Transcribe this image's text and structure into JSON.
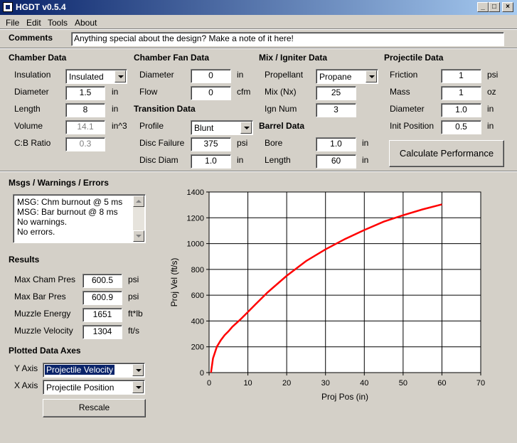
{
  "window": {
    "title": "HGDT v0.5.4"
  },
  "menu": [
    "File",
    "Edit",
    "Tools",
    "About"
  ],
  "comments": {
    "label": "Comments",
    "value": "Anything special about the design?  Make a note of it here!"
  },
  "chamber": {
    "title": "Chamber Data",
    "insulation": {
      "label": "Insulation",
      "value": "Insulated"
    },
    "diameter": {
      "label": "Diameter",
      "value": "1.5",
      "unit": "in"
    },
    "length": {
      "label": "Length",
      "value": "8",
      "unit": "in"
    },
    "volume": {
      "label": "Volume",
      "value": "14.1",
      "unit": "in^3"
    },
    "cb_ratio": {
      "label": "C:B Ratio",
      "value": "0.3"
    }
  },
  "fan": {
    "title": "Chamber Fan Data",
    "diameter": {
      "label": "Diameter",
      "value": "0",
      "unit": "in"
    },
    "flow": {
      "label": "Flow",
      "value": "0",
      "unit": "cfm"
    }
  },
  "transition": {
    "title": "Transition Data",
    "profile": {
      "label": "Profile",
      "value": "Blunt"
    },
    "disc_failure": {
      "label": "Disc Failure",
      "value": "375",
      "unit": "psi"
    },
    "disc_diam": {
      "label": "Disc Diam",
      "value": "1.0",
      "unit": "in"
    }
  },
  "mix": {
    "title": "Mix / Igniter Data",
    "propellant": {
      "label": "Propellant",
      "value": "Propane"
    },
    "mix": {
      "label": "Mix (Nx)",
      "value": "25"
    },
    "ign_num": {
      "label": "Ign Num",
      "value": "3"
    }
  },
  "barrel": {
    "title": "Barrel Data",
    "bore": {
      "label": "Bore",
      "value": "1.0",
      "unit": "in"
    },
    "length": {
      "label": "Length",
      "value": "60",
      "unit": "in"
    }
  },
  "projectile": {
    "title": "Projectile Data",
    "friction": {
      "label": "Friction",
      "value": "1",
      "unit": "psi"
    },
    "mass": {
      "label": "Mass",
      "value": "1",
      "unit": "oz"
    },
    "diameter": {
      "label": "Diameter",
      "value": "1.0",
      "unit": "in"
    },
    "init_position": {
      "label": "Init Position",
      "value": "0.5",
      "unit": "in"
    }
  },
  "calculate_button": "Calculate Performance",
  "messages": {
    "title": "Msgs / Warnings / Errors",
    "lines": [
      "MSG: Chm burnout @ 5 ms",
      "MSG: Bar burnout @ 8 ms",
      "No warnings.",
      "No errors."
    ]
  },
  "results": {
    "title": "Results",
    "max_cham_pres": {
      "label": "Max Cham Pres",
      "value": "600.5",
      "unit": "psi"
    },
    "max_bar_pres": {
      "label": "Max Bar Pres",
      "value": "600.9",
      "unit": "psi"
    },
    "muzzle_energy": {
      "label": "Muzzle Energy",
      "value": "1651",
      "unit": "ft*lb"
    },
    "muzzle_velocity": {
      "label": "Muzzle Velocity",
      "value": "1304",
      "unit": "ft/s"
    }
  },
  "axes": {
    "title": "Plotted Data Axes",
    "y_axis": {
      "label": "Y Axis",
      "value": "Projectile Velocity"
    },
    "x_axis": {
      "label": "X Axis",
      "value": "Projectile Position"
    },
    "rescale": "Rescale"
  },
  "chart_data": {
    "type": "line",
    "xlabel": "Proj Pos (in)",
    "ylabel": "Proj Vel (ft/s)",
    "xlim": [
      0,
      70
    ],
    "ylim": [
      0,
      1400
    ],
    "xticks": [
      "0",
      "10",
      "20",
      "30",
      "40",
      "50",
      "60",
      "70"
    ],
    "yticks": [
      "0",
      "200",
      "400",
      "600",
      "800",
      "1000",
      "1200",
      "1400"
    ],
    "grid": true,
    "line_color": "#ff0000",
    "series": [
      {
        "x": [
          0.5,
          1,
          2,
          3,
          4,
          5,
          6,
          8,
          10,
          12,
          15,
          20,
          25,
          30,
          35,
          40,
          45,
          50,
          55,
          60
        ],
        "y": [
          0,
          110,
          200,
          250,
          290,
          320,
          355,
          410,
          470,
          530,
          620,
          750,
          865,
          955,
          1035,
          1105,
          1170,
          1220,
          1265,
          1304
        ]
      }
    ]
  }
}
